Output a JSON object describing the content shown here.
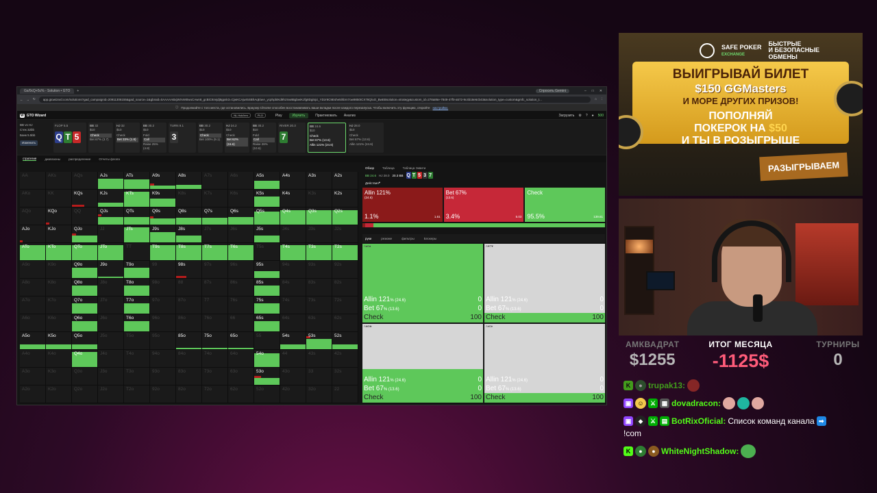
{
  "browser": {
    "tab_title": "Gs/0cQ+5c% - Solution • GTO",
    "gemini_btn": "Спросить Gemini",
    "url": "app.gtowizard.com/solutions?gad_campaignid=20911306155&gad_source=1&gbraid=0AAAAABxjWXvM0wuCAwn8_gcBiC9zejdj8gpsk3=CjwKCAjwr5SBhAqEiwA_ycphpbtKd9hzSw8BgbwiKJfg8Dgi5jci_YDzr9C9Eshe5ihbrn7ow9850ICX78Q/uO_BwEBsolution=strategy&custom_id=278a86e-7849-47f0-a572-9c4b18e6cb43&solution_type=custom&gmfc_solution_t...",
    "infobar_text": "Продолжайте с того места, где остановились. Браузер Chrome способен восстанавливать ваши вкладки после каждого перезапуска. Чтобы включить эту функцию, откройте",
    "infobar_link": "настройки."
  },
  "app": {
    "logo": "GTO Wizard",
    "cash_pill": "NL Hold'em",
    "plo_pill": "PLO",
    "nav": [
      "Play",
      "Изучить",
      "Практиковать",
      "Анализ"
    ],
    "upload": "Загрузить",
    "balance": "500"
  },
  "leftinfo": {
    "line1": "BB vs HJ",
    "line2": "Стек 32bb",
    "line3": "Банк 5.5bb",
    "change_btn": "Изменить"
  },
  "spots": [
    {
      "pos": "BB",
      "stack": "32",
      "size": "$10",
      "acts": [
        "Check",
        "Bet 67% (3.7)"
      ],
      "sel": 0
    },
    {
      "pos": "HJ",
      "stack": "32",
      "size": "$10",
      "acts": [
        "Check",
        "Bet 33% (1.8)"
      ],
      "sel": 1
    },
    {
      "pos": "BB",
      "stack": "30.2",
      "size": "$10",
      "acts": [
        "Fold",
        "Call",
        "Raise 25% (4.8)"
      ],
      "sel": 1
    }
  ],
  "boards": {
    "flop_label": "FLOP",
    "flop_pot": "5.5",
    "flop_cards": [
      {
        "r": "Q",
        "s": "s"
      },
      {
        "r": "T",
        "s": "c"
      },
      {
        "r": "5",
        "s": "h"
      }
    ],
    "turn_label": "TURN",
    "turn_pot": "9.1",
    "turn_cards": [
      {
        "r": "3",
        "s": "s"
      }
    ],
    "river_label": "RIVER",
    "river_pot": "20.3",
    "river_cards": [
      {
        "r": "7",
        "s": "c"
      }
    ]
  },
  "spots2": [
    {
      "pos": "BB",
      "stack": "30.2",
      "size": "$10",
      "acts": [
        "Check",
        "Bet 100% (9.1)"
      ],
      "sel": 0
    },
    {
      "pos": "HJ",
      "stack": "24.2",
      "size": "$10",
      "acts": [
        "Check",
        "Bet 62% (15.6)"
      ],
      "sel": 1
    },
    {
      "pos": "BB",
      "stack": "30.2",
      "size": "$10",
      "acts": [
        "Fold",
        "Call",
        "Raise 28% (10.6)"
      ],
      "sel": 1
    }
  ],
  "spot_active": {
    "pos": "BB",
    "stack": "24.6",
    "size": "$10",
    "acts": [
      "Check",
      "Bet 67% (13.6)",
      "Allin 121% (24.6)"
    ]
  },
  "spot_last": {
    "pos": "HJ",
    "stack": "28.0",
    "size": "$10",
    "acts": [
      "Check",
      "Bet 67% (13.6)",
      "Allin 121% (24.6)"
    ]
  },
  "subtabs": [
    "стратегия",
    "диапазоны",
    "распределение",
    "Отчеты флопа"
  ],
  "matrix": [
    [
      "AA",
      "AKs",
      "AQs",
      "AJs",
      "ATs",
      "A9s",
      "A8s",
      "A7s",
      "A6s",
      "A5s",
      "A4s",
      "A3s",
      "A2s"
    ],
    [
      "AKo",
      "KK",
      "KQs",
      "KJs",
      "KTs",
      "K9s",
      "K8s",
      "K7s",
      "K6s",
      "K5s",
      "K4s",
      "K3s",
      "K2s"
    ],
    [
      "AQo",
      "KQo",
      "QQ",
      "QJs",
      "QTs",
      "Q9s",
      "Q8s",
      "Q7s",
      "Q6s",
      "Q5s",
      "Q4s",
      "Q3s",
      "Q2s"
    ],
    [
      "AJo",
      "KJo",
      "QJo",
      "JJ",
      "JTs",
      "J9s",
      "J8s",
      "J7s",
      "J6s",
      "J5s",
      "J4s",
      "J3s",
      "J2s"
    ],
    [
      "ATo",
      "KTo",
      "QTo",
      "JTo",
      "TT",
      "T9s",
      "T8s",
      "T7s",
      "T6s",
      "T5s",
      "T4s",
      "T3s",
      "T2s"
    ],
    [
      "A9o",
      "K9o",
      "Q9o",
      "J9o",
      "T9o",
      "99",
      "98s",
      "97s",
      "96s",
      "95s",
      "94s",
      "93s",
      "92s"
    ],
    [
      "A8o",
      "K8o",
      "Q8o",
      "J8o",
      "T8o",
      "98o",
      "88",
      "87s",
      "86s",
      "85s",
      "84s",
      "83s",
      "82s"
    ],
    [
      "A7o",
      "K7o",
      "Q7o",
      "J7o",
      "T7o",
      "97o",
      "87o",
      "77",
      "76s",
      "75s",
      "74s",
      "73s",
      "72s"
    ],
    [
      "A6o",
      "K6o",
      "Q6o",
      "J6o",
      "T6o",
      "96o",
      "86o",
      "76o",
      "66",
      "65s",
      "64s",
      "63s",
      "62s"
    ],
    [
      "A5o",
      "K5o",
      "Q5o",
      "J5o",
      "T5o",
      "95o",
      "85o",
      "75o",
      "65o",
      "55",
      "54s",
      "53s",
      "52s"
    ],
    [
      "A4o",
      "K4o",
      "Q4o",
      "J4o",
      "T4o",
      "94o",
      "84o",
      "74o",
      "64o",
      "54o",
      "44",
      "43s",
      "42s"
    ],
    [
      "A3o",
      "K3o",
      "Q3o",
      "J3o",
      "T3o",
      "93o",
      "83o",
      "73o",
      "63o",
      "53o",
      "43o",
      "33",
      "32s"
    ],
    [
      "A2o",
      "K2o",
      "Q2o",
      "J2o",
      "T2o",
      "92o",
      "82o",
      "72o",
      "62o",
      "52o",
      "42o",
      "32o",
      "22"
    ]
  ],
  "right": {
    "tabs": [
      "Обзор",
      "Таблица",
      "Таблица Эквити"
    ],
    "summary": [
      "BB 24.6",
      "HJ 28.0",
      "20.3 BB"
    ],
    "summary_cards": [
      {
        "r": "Q",
        "s": "s"
      },
      {
        "r": "T",
        "s": "c"
      },
      {
        "r": "5",
        "s": "h"
      },
      {
        "r": "3",
        "s": "s"
      },
      {
        "r": "7",
        "s": "c"
      }
    ],
    "actions_label": "Действия",
    "boxes": [
      {
        "label": "Allin 121%",
        "sub": "(24.6)",
        "pct": "1.1%",
        "num": "1.61"
      },
      {
        "label": "Bet 67%",
        "sub": "(13.6)",
        "pct": "3.4%",
        "num": "5.03"
      },
      {
        "label": "Check",
        "sub": "",
        "pct": "95.5%",
        "num": "139.61"
      }
    ],
    "freq": [
      1.1,
      3.4,
      95.5
    ],
    "hand_tabs": [
      "руки",
      "резюме",
      "фильтры",
      "Блокеры"
    ],
    "combos": [
      {
        "hdr": "A♠6♠",
        "fill": 1.0
      },
      {
        "hdr": "A♥7♥",
        "fill": 0.12
      },
      {
        "hdr": "A♣9♣",
        "fill": 0.43
      },
      {
        "hdr": "A♦6♦",
        "fill": 0.12
      }
    ],
    "combo_rows": [
      {
        "name": "Allin 121",
        "sub": "% (24.6)",
        "val": "0"
      },
      {
        "name": "Bet 67",
        "sub": "% (13.6)",
        "val": "0"
      },
      {
        "name": "Check",
        "sub": "",
        "val": "100"
      }
    ]
  },
  "ad": {
    "brand_line1": "SAFE POKER",
    "brand_line2": "EXCHANGE",
    "tag1": "БЫСТРЫЕ",
    "tag2": "И БЕЗОПАСНЫЕ",
    "tag3": "ОБМЕНЫ",
    "l1": "ВЫИГРЫВАЙ БИЛЕТ",
    "l2": "$150 GGMasters",
    "l3": "И МОРЕ ДРУГИХ ПРИЗОВ!",
    "l4a": "ПОПОЛНЯЙ",
    "l4b": "ПОКЕРОК НА ",
    "l4c": "$50",
    "l5": "И ТЫ В РОЗЫГРЫШЕ",
    "draw": "РАЗЫГРЫВАЕМ"
  },
  "stats": {
    "left_h": "АМКВАДРАТ",
    "left_v": "$1255",
    "mid_h": "ИТОГ МЕСЯЦА",
    "mid_v": "-1125$",
    "right_h": "ТУРНИРЫ",
    "right_v": "0"
  },
  "chat": [
    {
      "user": "trupak13:",
      "text": ""
    },
    {
      "user": "dovadracon:",
      "text": ""
    },
    {
      "user": "BotRixOficial:",
      "text": "Список команд канала"
    },
    {
      "user": "",
      "text": "!com"
    },
    {
      "user": "WhiteNightShadow:",
      "text": ""
    }
  ],
  "colors": {
    "check": "#5ec85a",
    "bet": "#c62838",
    "allin": "#8b1a1a",
    "accent": "#6fdc6f",
    "loss": "#ff5c7a"
  }
}
